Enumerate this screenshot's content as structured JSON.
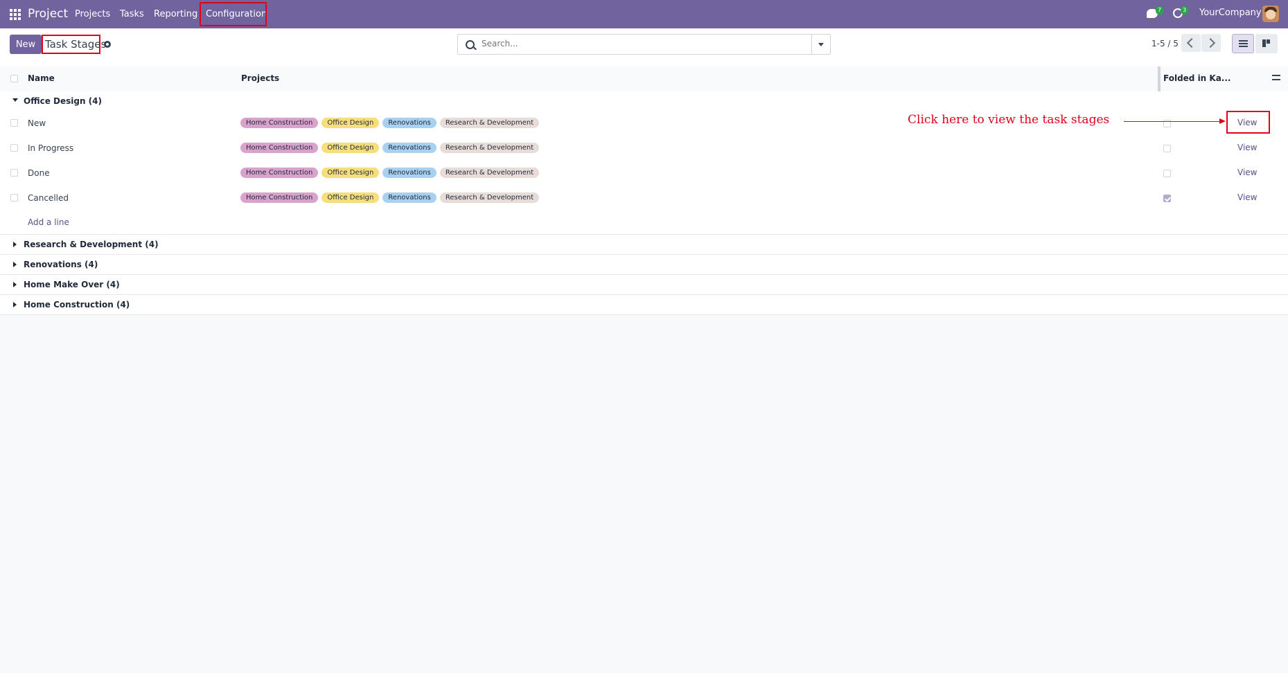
{
  "navbar": {
    "app_name": "Project",
    "menu": [
      "Projects",
      "Tasks",
      "Reporting",
      "Configuration"
    ],
    "messages_count": "7",
    "activities_count": "3",
    "company": "YourCompany"
  },
  "control_panel": {
    "new_label": "New",
    "breadcrumb": "Task Stages",
    "search_placeholder": "Search...",
    "pager": "1-5 / 5"
  },
  "table": {
    "columns": [
      "Name",
      "Projects",
      "Folded in Ka..."
    ],
    "open_group": "Office Design (4)",
    "rows": [
      {
        "name": "New",
        "folded": false,
        "action": "View"
      },
      {
        "name": "In Progress",
        "folded": false,
        "action": "View"
      },
      {
        "name": "Done",
        "folded": false,
        "action": "View"
      },
      {
        "name": "Cancelled",
        "folded": true,
        "action": "View"
      }
    ],
    "tags": [
      "Home Construction",
      "Office Design",
      "Renovations",
      "Research & Development"
    ],
    "tag_colors": [
      "#d8a2cc",
      "#f7de7d",
      "#a8d0f0",
      "#e8dcd9"
    ],
    "add_line": "Add a line",
    "collapsed_groups": [
      "Research & Development (4)",
      "Renovations (4)",
      "Home Make Over (4)",
      "Home Construction (4)"
    ]
  },
  "annotation": {
    "text": "Click here to view the task stages",
    "color": "#e0001a"
  },
  "colors": {
    "brand": "#71639e",
    "link": "#5b4e8a"
  }
}
